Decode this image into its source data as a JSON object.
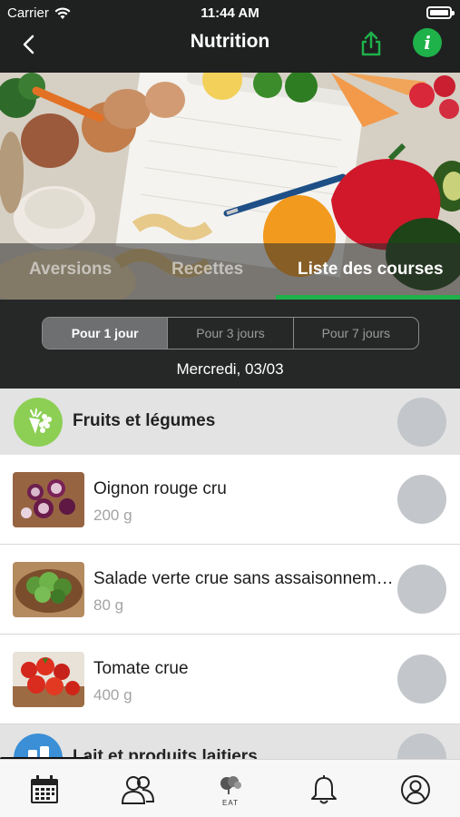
{
  "status_bar": {
    "carrier": "Carrier",
    "time": "11:44 AM"
  },
  "nav": {
    "title": "Nutrition",
    "back_icon": "chevron-left-icon",
    "share_icon": "share-icon",
    "info_icon": "info-icon",
    "info_glyph": "i"
  },
  "tabs": [
    {
      "label": "Aversions",
      "active": false
    },
    {
      "label": "Recettes",
      "active": false
    },
    {
      "label": "Liste des courses",
      "active": true
    }
  ],
  "period": {
    "options": [
      "Pour 1 jour",
      "Pour 3 jours",
      "Pour 7 jours"
    ],
    "selected": "Pour 1 jour",
    "date": "Mercredi, 03/03"
  },
  "sections": [
    {
      "title": "Fruits et légumes",
      "icon": "produce-icon",
      "items": [
        {
          "name": "Oignon rouge cru",
          "qty": "200 g"
        },
        {
          "name": "Salade verte crue sans assaisonnement",
          "qty": "80 g"
        },
        {
          "name": "Tomate crue",
          "qty": "400 g"
        }
      ]
    },
    {
      "title": "Lait et produits laitiers",
      "icon": "dairy-icon",
      "items": []
    }
  ],
  "bottom_nav": [
    {
      "icon": "calendar-icon"
    },
    {
      "icon": "people-icon"
    },
    {
      "icon": "eat-logo-icon",
      "logo_text": "EAT"
    },
    {
      "icon": "bell-icon"
    },
    {
      "icon": "profile-icon"
    }
  ],
  "colors": {
    "accent": "#1fb14a",
    "header_bg": "#1f2020",
    "section_bg": "#e3e3e3",
    "check_gray": "#c3c6ca"
  }
}
